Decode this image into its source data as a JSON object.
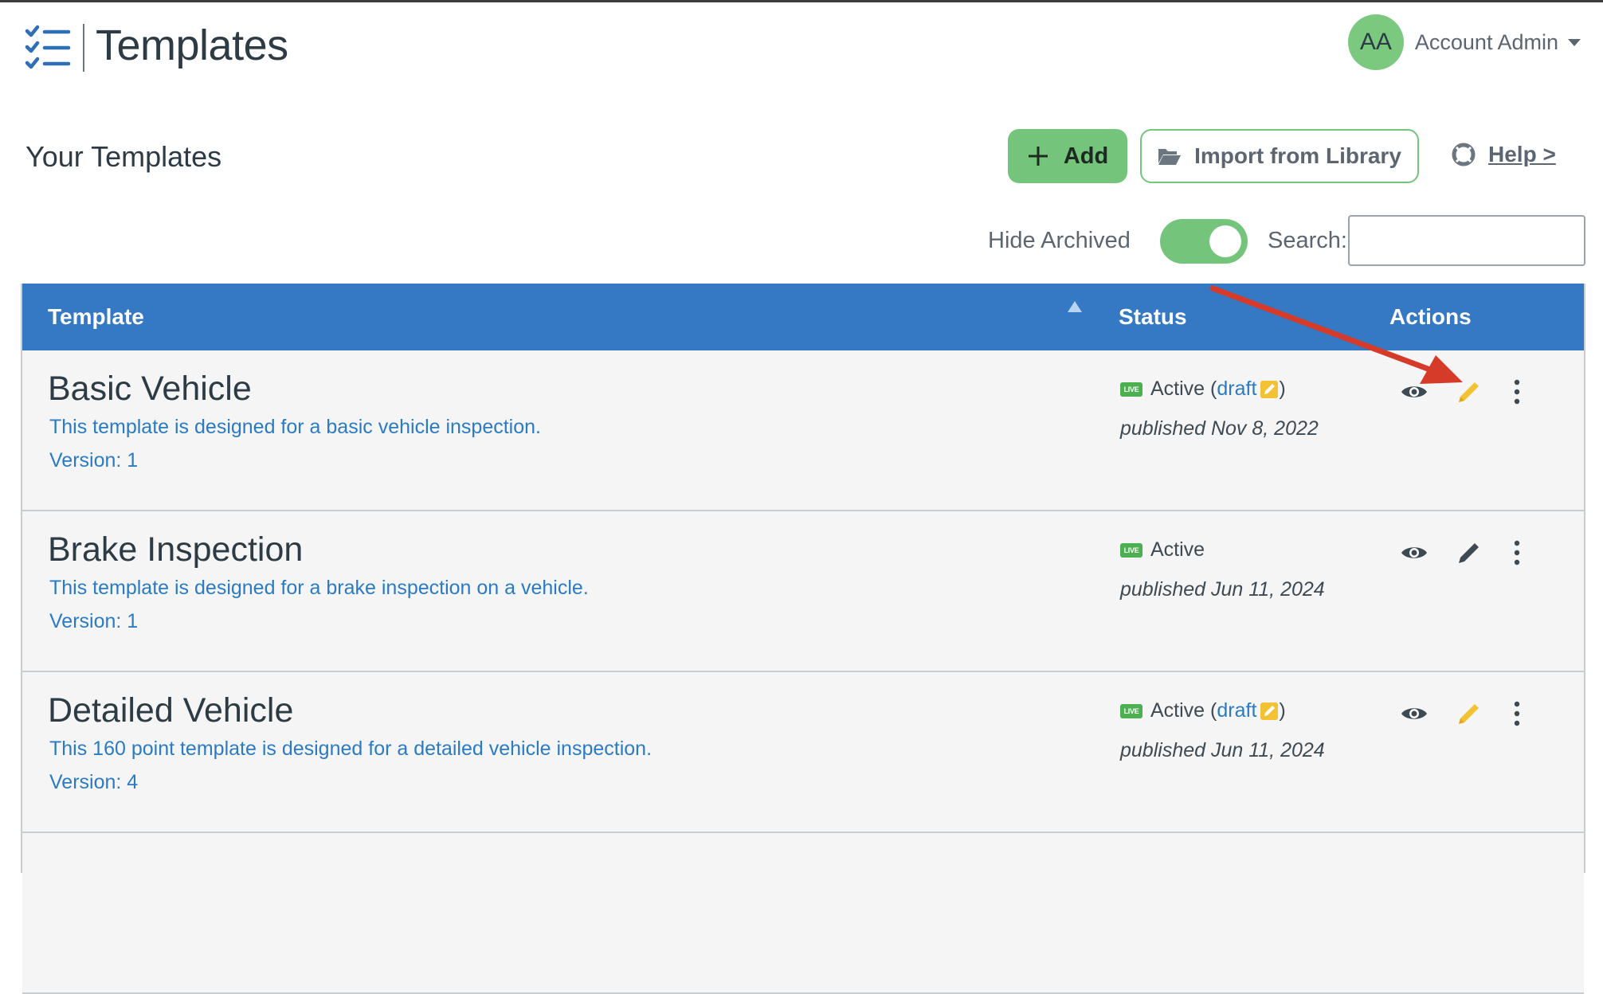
{
  "app": {
    "title": "Templates"
  },
  "account": {
    "initials": "AA",
    "name": "Account Admin"
  },
  "toolbar": {
    "section_title": "Your Templates",
    "add_label": "Add",
    "import_label": "Import from Library",
    "help_label": "Help >",
    "hide_archived_label": "Hide Archived",
    "hide_archived_on": true,
    "search_label": "Search:",
    "search_value": ""
  },
  "table": {
    "columns": {
      "template": "Template",
      "status": "Status",
      "actions": "Actions"
    },
    "rows": [
      {
        "name": "Basic Vehicle",
        "description": "This template is designed for a basic vehicle inspection.",
        "version": "Version: 1",
        "status": "Active",
        "has_draft": true,
        "draft_label": "draft",
        "published": "published Nov 8, 2022"
      },
      {
        "name": "Brake Inspection",
        "description": "This template is designed for a brake inspection on a vehicle.",
        "version": "Version: 1",
        "status": "Active",
        "has_draft": false,
        "draft_label": "",
        "published": "published Jun 11, 2024"
      },
      {
        "name": "Detailed Vehicle",
        "description": "This 160 point template is designed for a detailed vehicle inspection.",
        "version": "Version: 4",
        "status": "Active",
        "has_draft": true,
        "draft_label": "draft",
        "published": "published Jun 11, 2024"
      }
    ]
  },
  "badges": {
    "live": "LIVE"
  },
  "icons": {
    "logo": "checklist-icon",
    "add": "plus-icon",
    "import": "folder-open-icon",
    "help": "lifering-icon",
    "view": "eye-icon",
    "edit": "pencil-icon",
    "more": "more-vertical-icon",
    "draft": "draft-pencil-icon"
  },
  "colors": {
    "header_blue": "#3578c4",
    "accent_green": "#74c57b",
    "link_blue": "#2b7bc4",
    "draft_yellow": "#f2c233",
    "annotation_red": "#d63b2a"
  }
}
